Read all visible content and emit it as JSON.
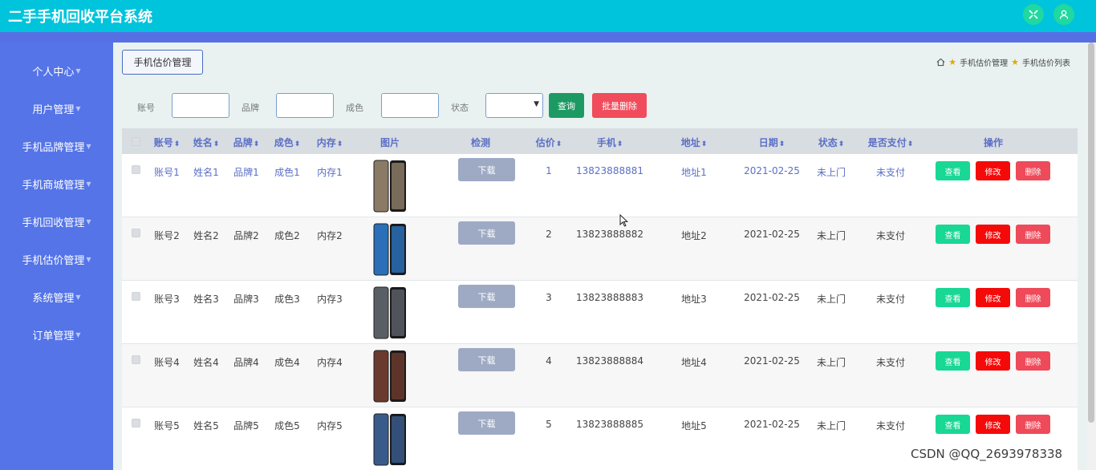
{
  "app": {
    "title": "二手手机回收平台系统"
  },
  "sidebar": {
    "items": [
      {
        "label": "个人中心"
      },
      {
        "label": "用户管理"
      },
      {
        "label": "手机品牌管理"
      },
      {
        "label": "手机商城管理"
      },
      {
        "label": "手机回收管理"
      },
      {
        "label": "手机估价管理"
      },
      {
        "label": "系统管理"
      },
      {
        "label": "订单管理"
      }
    ]
  },
  "page": {
    "tag": "手机估价管理",
    "breadcrumb": [
      "手机估价管理",
      "手机估价列表"
    ]
  },
  "filters": {
    "account_label": "账号",
    "brand_label": "品牌",
    "condition_label": "成色",
    "status_label": "状态",
    "query_button": "查询",
    "batch_delete_button": "批量删除"
  },
  "table": {
    "headers": {
      "account": "账号",
      "name": "姓名",
      "brand": "品牌",
      "condition": "成色",
      "memory": "内存",
      "image": "图片",
      "detect": "检测",
      "price": "估价",
      "phone": "手机",
      "address": "地址",
      "date": "日期",
      "status": "状态",
      "paid": "是否支付",
      "actions": "操作"
    },
    "sort_symbol": "⬍",
    "rows": [
      {
        "account": "账号1",
        "name": "姓名1",
        "brand": "品牌1",
        "condition": "成色1",
        "memory": "内存1",
        "detect": "下载",
        "price": "1",
        "phone": "13823888881",
        "address": "地址1",
        "date": "2021-02-25",
        "status": "未上门",
        "paid": "未支付",
        "view": "查看",
        "edit": "修改",
        "del": "删除",
        "img_color": "#8a7a66"
      },
      {
        "account": "账号2",
        "name": "姓名2",
        "brand": "品牌2",
        "condition": "成色2",
        "memory": "内存2",
        "detect": "下载",
        "price": "2",
        "phone": "13823888882",
        "address": "地址2",
        "date": "2021-02-25",
        "status": "未上门",
        "paid": "未支付",
        "view": "查看",
        "edit": "修改",
        "del": "删除",
        "img_color": "#2a6fb8"
      },
      {
        "account": "账号3",
        "name": "姓名3",
        "brand": "品牌3",
        "condition": "成色3",
        "memory": "内存3",
        "detect": "下载",
        "price": "3",
        "phone": "13823888883",
        "address": "地址3",
        "date": "2021-02-25",
        "status": "未上门",
        "paid": "未支付",
        "view": "查看",
        "edit": "修改",
        "del": "删除",
        "img_color": "#5a5f66"
      },
      {
        "account": "账号4",
        "name": "姓名4",
        "brand": "品牌4",
        "condition": "成色4",
        "memory": "内存4",
        "detect": "下载",
        "price": "4",
        "phone": "13823888884",
        "address": "地址4",
        "date": "2021-02-25",
        "status": "未上门",
        "paid": "未支付",
        "view": "查看",
        "edit": "修改",
        "del": "删除",
        "img_color": "#6a3a2e"
      },
      {
        "account": "账号5",
        "name": "姓名5",
        "brand": "品牌5",
        "condition": "成色5",
        "memory": "内存5",
        "detect": "下载",
        "price": "5",
        "phone": "13823888885",
        "address": "地址5",
        "date": "2021-02-25",
        "status": "未上门",
        "paid": "未支付",
        "view": "查看",
        "edit": "修改",
        "del": "删除",
        "img_color": "#3a5a8a"
      }
    ]
  },
  "watermark": "CSDN @QQ_2693978338",
  "colors": {
    "topbar": "#00c4dc",
    "sidebar": "#5474e8",
    "view": "#19d795",
    "edit": "#f50a0a",
    "delete": "#ee4a5a",
    "query": "#1d9a64"
  }
}
